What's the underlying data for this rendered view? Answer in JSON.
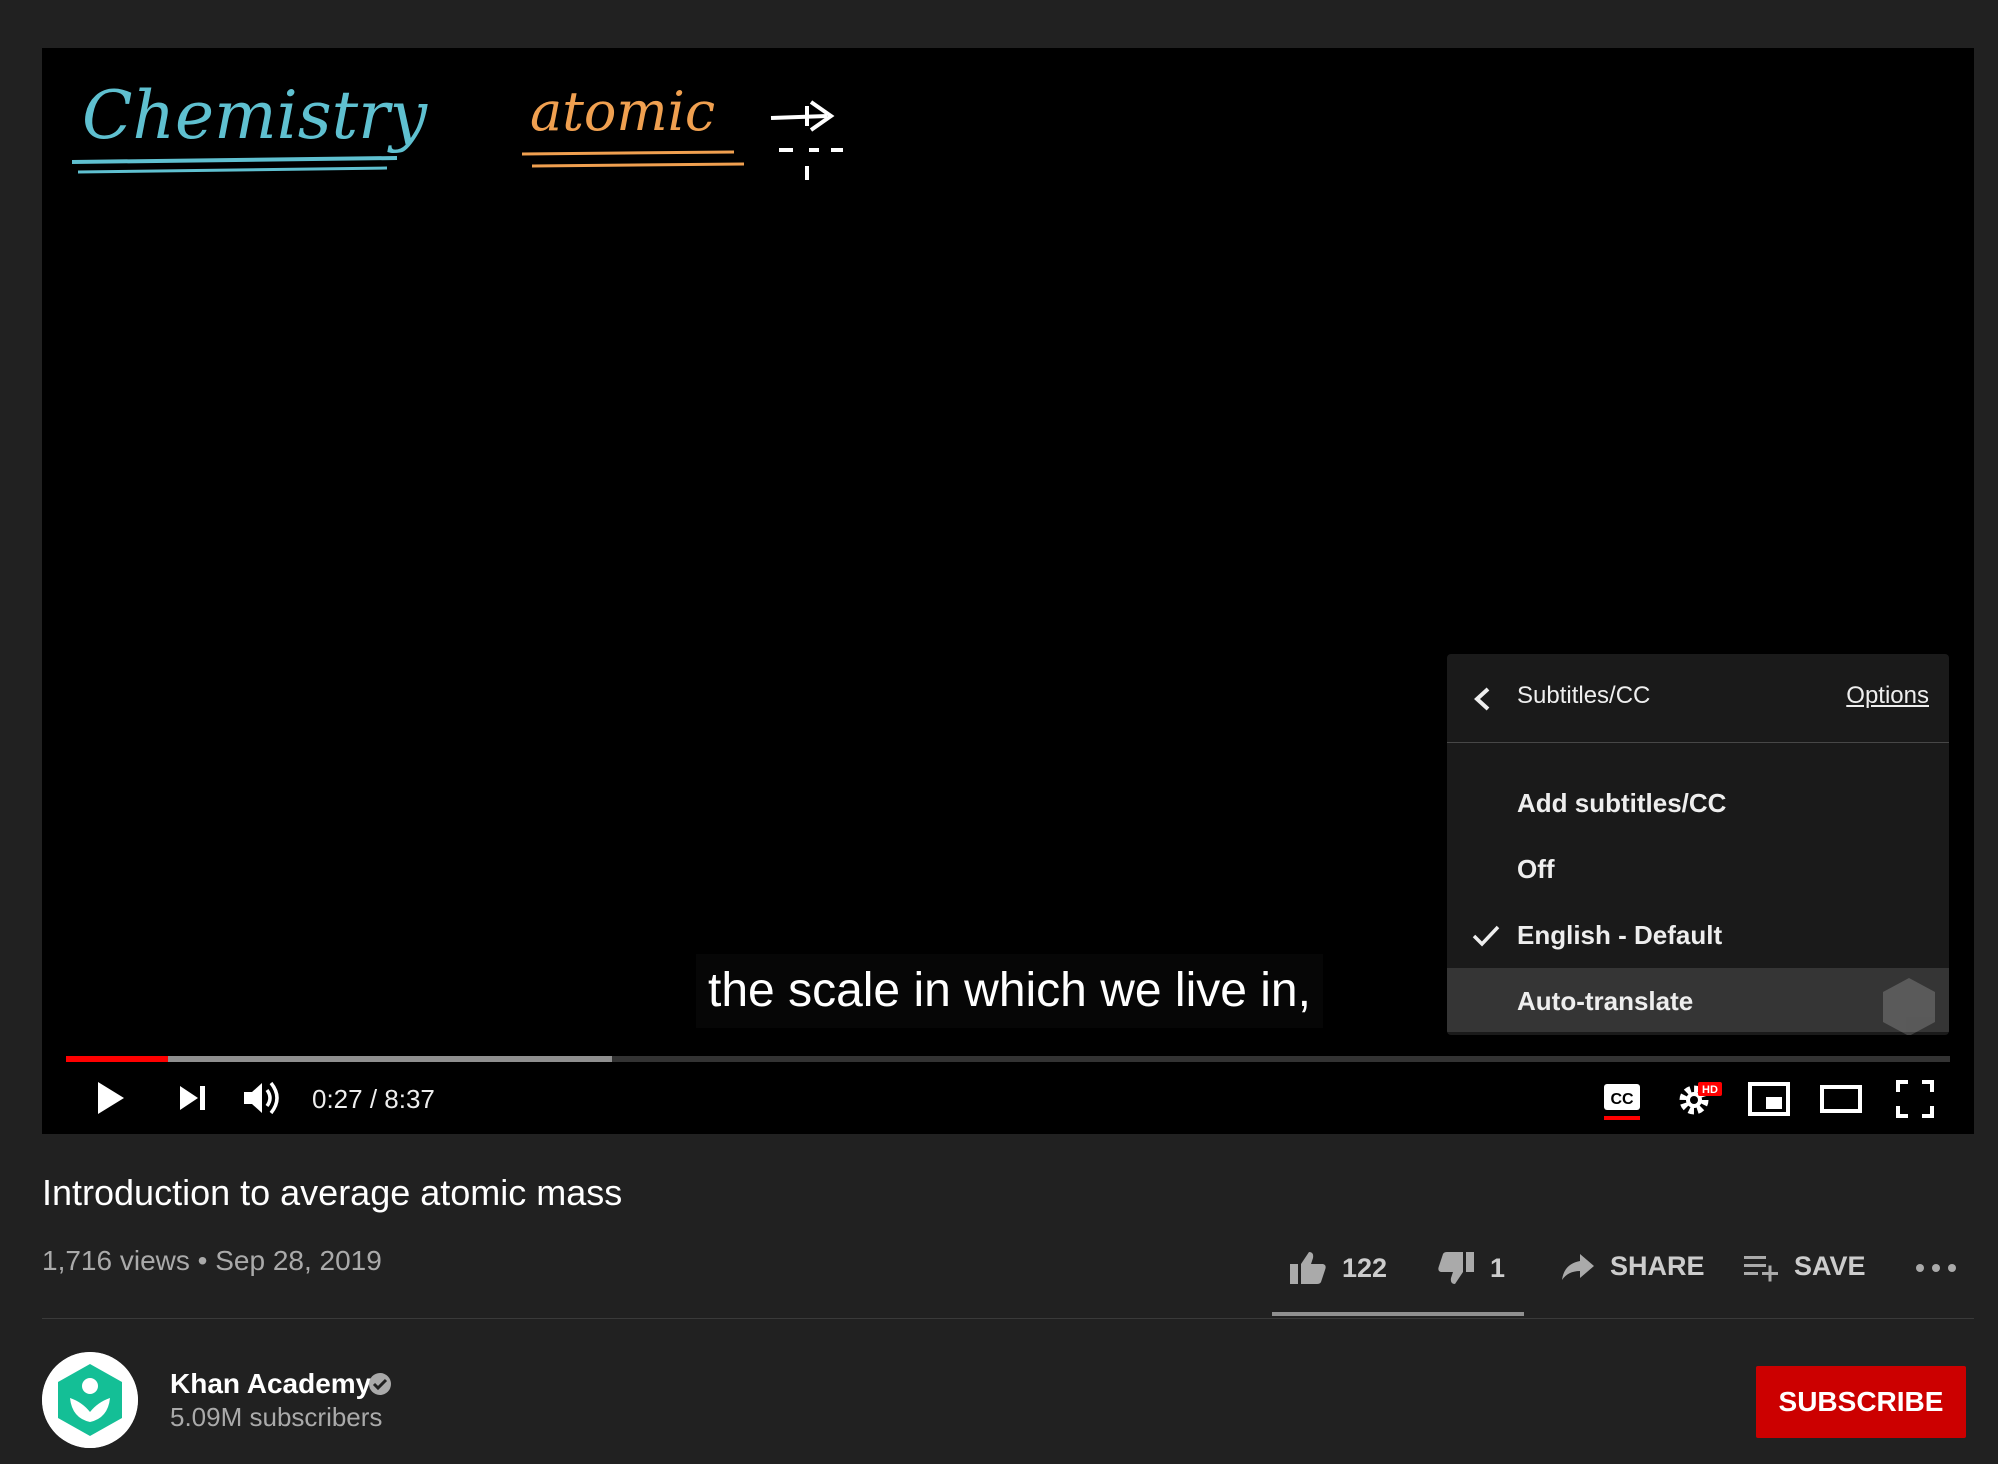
{
  "video": {
    "handwriting": {
      "word1": "Chemistry",
      "word2": "atomic"
    },
    "caption_text": "the scale in which we live in,",
    "progress": {
      "played_fraction": 0.054,
      "buffered_fraction": 0.29
    },
    "time_display": "0:27 / 8:37",
    "settings_badge": "HD"
  },
  "subtitles_menu": {
    "title": "Subtitles/CC",
    "options_link": "Options",
    "items": [
      {
        "label": "Add subtitles/CC",
        "selected": false
      },
      {
        "label": "Off",
        "selected": false
      },
      {
        "label": "English - Default",
        "selected": true
      },
      {
        "label": "Auto-translate",
        "selected": false,
        "highlighted": true
      }
    ]
  },
  "details": {
    "title": "Introduction to average atomic mass",
    "meta": "1,716 views • Sep 28, 2019",
    "likes": "122",
    "dislikes": "1",
    "share_label": "SHARE",
    "save_label": "SAVE"
  },
  "channel": {
    "name": "Khan Academy",
    "subscribers": "5.09M subscribers",
    "subscribe_label": "SUBSCRIBE"
  },
  "colors": {
    "background": "#212121",
    "progress": "#ff0000",
    "subscribe": "#cc0000",
    "handwriting_blue": "#5fc0d0",
    "handwriting_orange": "#f0a050",
    "khan_green": "#14bf96"
  }
}
